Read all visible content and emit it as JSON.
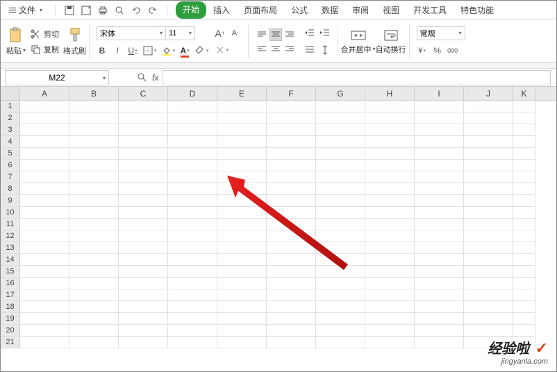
{
  "menu": {
    "file": "文件",
    "tabs": [
      "开始",
      "插入",
      "页面布局",
      "公式",
      "数据",
      "审阅",
      "视图",
      "开发工具",
      "特色功能"
    ]
  },
  "ribbon": {
    "clipboard": {
      "cut": "剪切",
      "copy": "复制",
      "paste": "粘贴",
      "format_painter": "格式刷"
    },
    "font": {
      "name": "宋体",
      "size": "11",
      "bold": "B",
      "italic": "I",
      "underline": "U",
      "increase": "A",
      "decrease": "A"
    },
    "merge": "合并居中",
    "wrap": "自动换行",
    "number_format": "常规",
    "currency_hint": "%",
    "thousands": "000"
  },
  "formula_bar": {
    "name_box": "M22",
    "fx": "fx"
  },
  "columns": [
    "A",
    "B",
    "C",
    "D",
    "E",
    "F",
    "G",
    "H",
    "I",
    "J",
    "K"
  ],
  "rows": [
    "1",
    "2",
    "3",
    "4",
    "5",
    "6",
    "7",
    "8",
    "9",
    "10",
    "11",
    "12",
    "13",
    "14",
    "15",
    "16",
    "17",
    "18",
    "19",
    "20",
    "21"
  ],
  "watermark": {
    "brand": "经验啦",
    "url": "jingyanla.com"
  }
}
